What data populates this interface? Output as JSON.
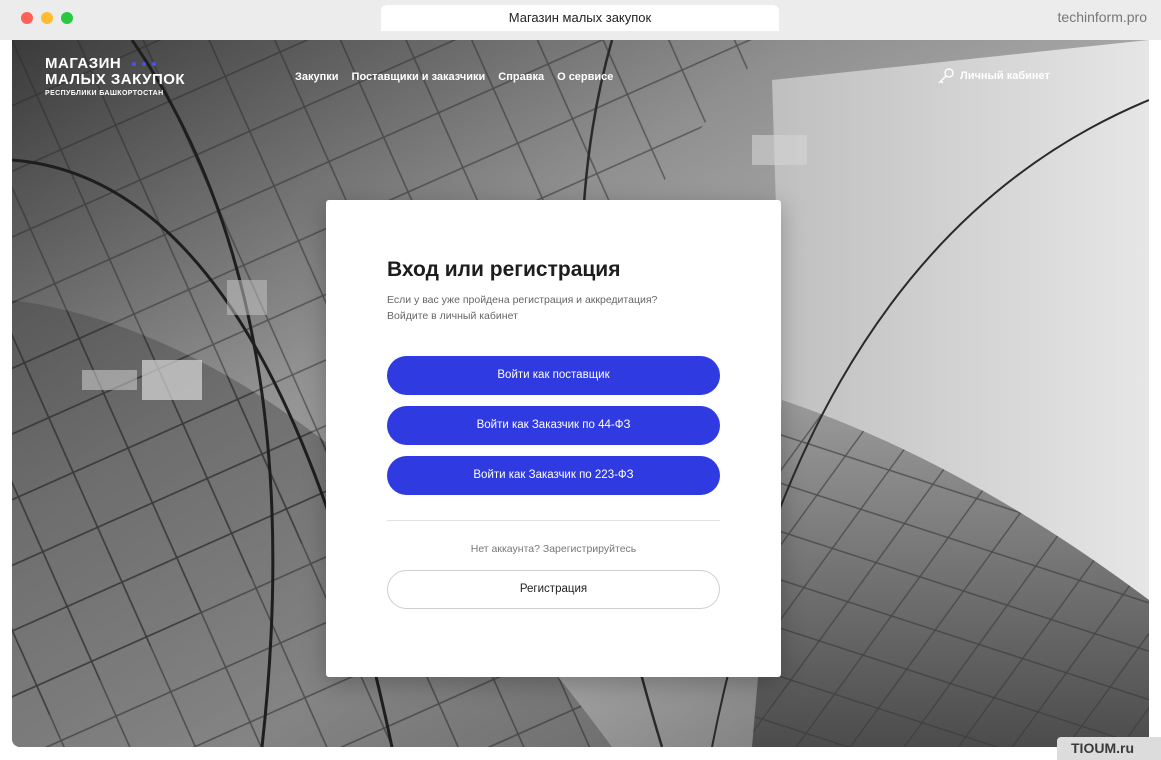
{
  "browser": {
    "tab_title": "Магазин малых закупок",
    "host": "techinform.pro"
  },
  "header": {
    "logo_line1": "МАГАЗИН",
    "logo_line2": "МАЛЫХ ЗАКУПОК",
    "logo_line3": "РЕСПУБЛИКИ БАШКОРТОСТАН",
    "nav": [
      "Закупки",
      "Поставщики и заказчики",
      "Справка",
      "О сервисе"
    ],
    "account_label": "Личный кабинет"
  },
  "login": {
    "title": "Вход или регистрация",
    "subtitle_line1": "Если у вас уже пройдена регистрация и аккредитация?",
    "subtitle_line2": "Войдите в личный кабинет",
    "buttons": [
      "Войти как поставщик",
      "Войти как Заказчик по 44-ФЗ",
      "Войти как Заказчик по 223-ФЗ"
    ],
    "no_account": "Нет аккаунта? Зарегистрируйтесь",
    "register_label": "Регистрация"
  },
  "watermark": "TIOUM.ru",
  "colors": {
    "primary": "#2f3ae0",
    "logo_dots": "#4a55e6"
  }
}
